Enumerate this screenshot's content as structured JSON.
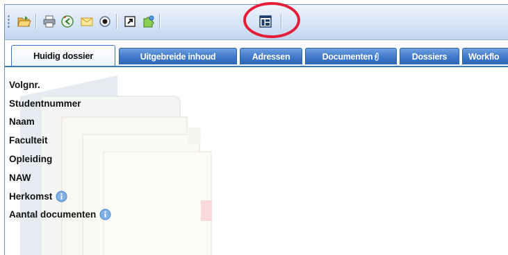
{
  "toolbar": {
    "buttons": [
      {
        "icon": "open-folder-icon"
      },
      {
        "icon": "printer-icon"
      },
      {
        "icon": "back-arrow-icon"
      },
      {
        "icon": "envelope-icon"
      },
      {
        "icon": "eye-icon"
      },
      {
        "icon": "external-link-icon"
      },
      {
        "icon": "puzzle-icon"
      },
      {
        "icon": "layout-panel-icon",
        "highlighted": true
      }
    ],
    "highlight_color": "#e51e37"
  },
  "tabs": [
    {
      "label": "Huidig dossier",
      "active": true
    },
    {
      "label": "Uitgebreide inhoud",
      "active": false
    },
    {
      "label": "Adressen",
      "active": false
    },
    {
      "label": "Documenten",
      "active": false,
      "icon": "paperclip-icon"
    },
    {
      "label": "Dossiers",
      "active": false
    },
    {
      "label": "Workflo",
      "active": false
    }
  ],
  "fields": [
    {
      "label": "Volgnr."
    },
    {
      "label": "Studentnummer"
    },
    {
      "label": "Naam"
    },
    {
      "label": "Faculteit"
    },
    {
      "label": "Opleiding"
    },
    {
      "label": "NAW"
    },
    {
      "label": "Herkomst",
      "info": true
    },
    {
      "label": "Aantal documenten",
      "info": true
    }
  ],
  "colors": {
    "tab_blue": "#3e78c9",
    "toolbar_bg": "#d6e4f6",
    "info_icon": "#6fa0d8"
  }
}
